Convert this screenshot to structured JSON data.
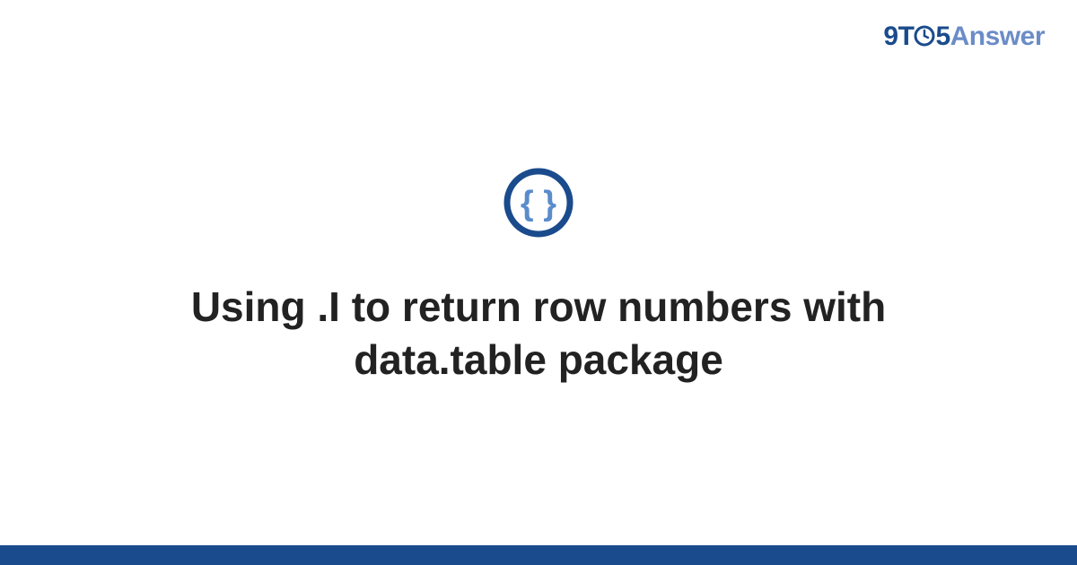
{
  "brand": {
    "prefix": "9T",
    "middle": "5",
    "suffix": "Answer"
  },
  "category_icon": "code-braces-icon",
  "title": "Using .I to return row numbers with data.table package",
  "colors": {
    "brand_dark": "#1a4b8c",
    "brand_light": "#6b8cc7",
    "icon_inner": "#5a8ccc",
    "bar": "#1a4b8c"
  }
}
